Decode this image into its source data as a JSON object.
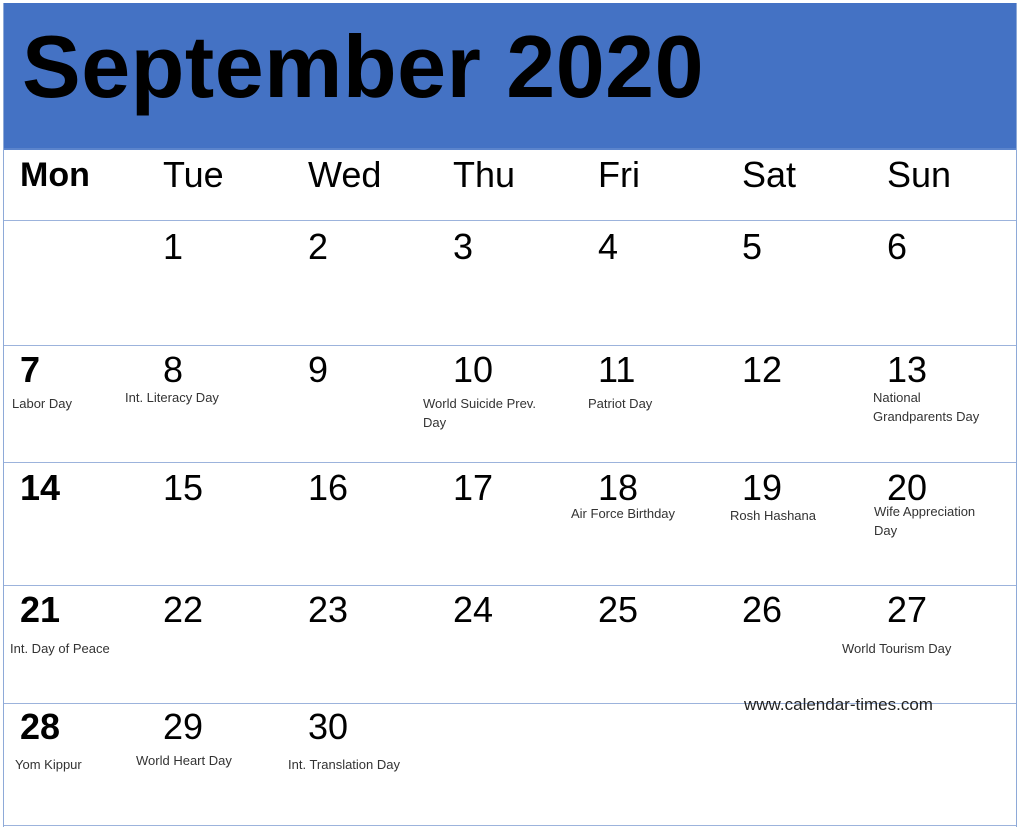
{
  "title": "September 2020",
  "colors": {
    "header_bg": "#4472C4",
    "grid_line": "#9cb3dc",
    "text": "#000000",
    "event_text": "#333333"
  },
  "weekdays": [
    "Mon",
    "Tue",
    "Wed",
    "Thu",
    "Fri",
    "Sat",
    "Sun"
  ],
  "weeks": [
    [
      {
        "day": "",
        "events": []
      },
      {
        "day": "1",
        "events": []
      },
      {
        "day": "2",
        "events": []
      },
      {
        "day": "3",
        "events": []
      },
      {
        "day": "4",
        "events": []
      },
      {
        "day": "5",
        "events": []
      },
      {
        "day": "6",
        "events": []
      }
    ],
    [
      {
        "day": "7",
        "events": [
          "Labor Day"
        ]
      },
      {
        "day": "8",
        "events": [
          "Int. Literacy Day"
        ]
      },
      {
        "day": "9",
        "events": []
      },
      {
        "day": "10",
        "events": [
          "World Suicide Prev.",
          "Day"
        ]
      },
      {
        "day": "11",
        "events": [
          "Patriot Day"
        ]
      },
      {
        "day": "12",
        "events": []
      },
      {
        "day": "13",
        "events": [
          "National",
          " Grandparents Day"
        ]
      }
    ],
    [
      {
        "day": "14",
        "events": []
      },
      {
        "day": "15",
        "events": []
      },
      {
        "day": "16",
        "events": []
      },
      {
        "day": "17",
        "events": []
      },
      {
        "day": "18",
        "events": [
          "Air Force Birthday"
        ]
      },
      {
        "day": "19",
        "events": [
          "Rosh Hashana"
        ]
      },
      {
        "day": "20",
        "events": [
          "Wife Appreciation",
          "Day"
        ]
      }
    ],
    [
      {
        "day": "21",
        "events": [
          "Int. Day of Peace"
        ]
      },
      {
        "day": "22",
        "events": []
      },
      {
        "day": "23",
        "events": []
      },
      {
        "day": "24",
        "events": []
      },
      {
        "day": "25",
        "events": []
      },
      {
        "day": "26",
        "events": []
      },
      {
        "day": "27",
        "events": [
          "World Tourism Day"
        ]
      }
    ],
    [
      {
        "day": "28",
        "events": [
          "Yom Kippur"
        ]
      },
      {
        "day": "29",
        "events": [
          "World Heart Day"
        ]
      },
      {
        "day": "30",
        "events": [
          "Int. Translation Day"
        ]
      },
      {
        "day": "",
        "events": []
      },
      {
        "day": "",
        "events": []
      },
      {
        "day": "",
        "events": []
      },
      {
        "day": "",
        "events": []
      }
    ]
  ],
  "watermark": "www.calendar-times.com"
}
